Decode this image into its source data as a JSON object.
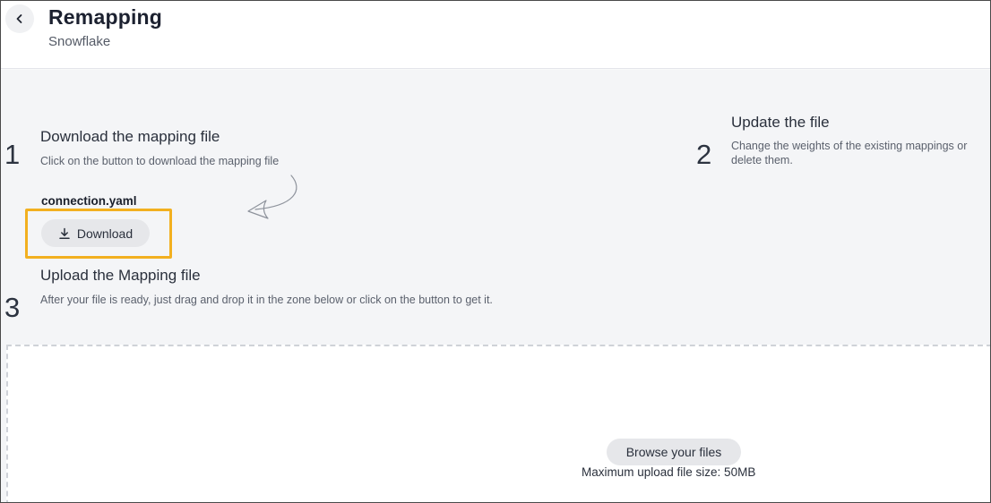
{
  "header": {
    "title": "Remapping",
    "subtitle": "Snowflake"
  },
  "steps": [
    {
      "number": "1",
      "title": "Download the mapping file",
      "description": "Click on the button to download the mapping file"
    },
    {
      "number": "2",
      "title": "Update the file",
      "description": "Change the weights of the existing mappings or delete them."
    },
    {
      "number": "3",
      "title": "Upload the Mapping file",
      "description": "After your file is ready, just drag and drop it in the zone below or click on the button to get it."
    }
  ],
  "download": {
    "file_name": "connection.yaml",
    "button_label": "Download",
    "icon": "download-icon"
  },
  "upload": {
    "browse_label": "Browse your files",
    "max_size": "Maximum upload file size: 50MB"
  },
  "colors": {
    "highlight": "#f2b020",
    "background": "#f4f5f7",
    "button": "#e6e7ea"
  },
  "icons": {
    "back": "chevron-left-icon",
    "hint": "curved-arrow-icon"
  }
}
